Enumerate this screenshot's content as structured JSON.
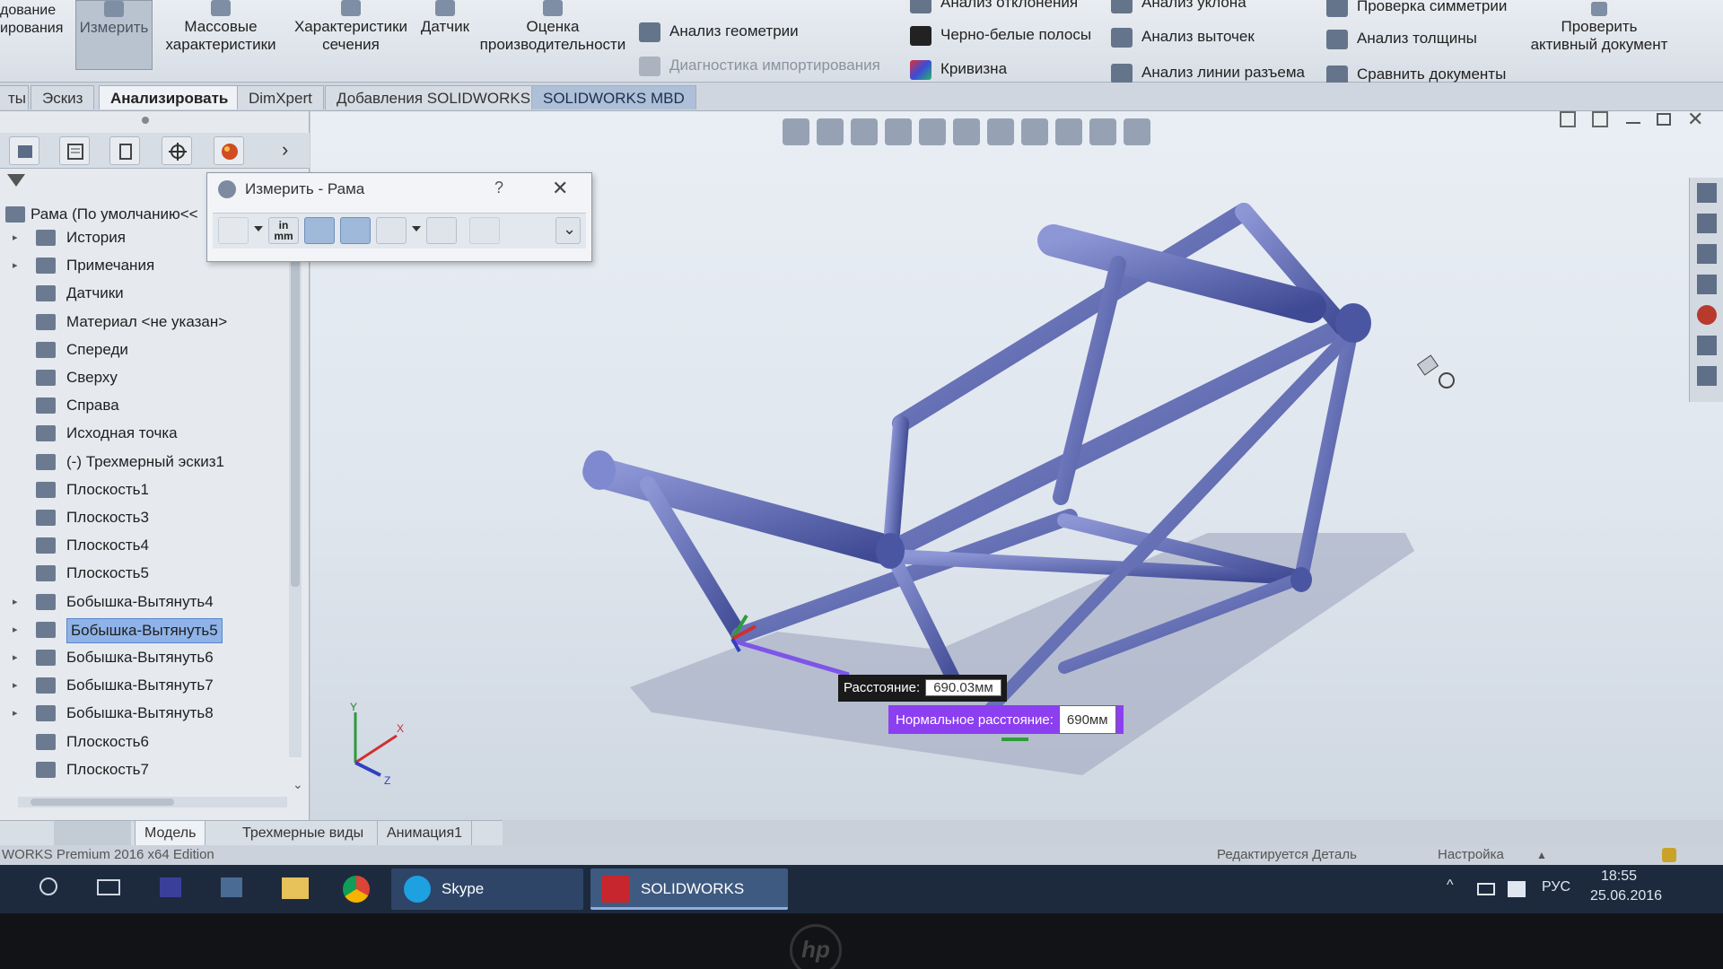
{
  "ribbon": {
    "left_partial": "дование\nирования",
    "tools": [
      {
        "label": "Измерить",
        "icon": "measure-icon"
      },
      {
        "label": "Массовые\nхарактеристики",
        "icon": "mass-properties-icon"
      },
      {
        "label": "Характеристики\nсечения",
        "icon": "section-properties-icon"
      },
      {
        "label": "Датчик",
        "icon": "sensor-icon"
      },
      {
        "label": "Оценка\nпроизводительности",
        "icon": "performance-icon"
      }
    ],
    "list_col1": [
      {
        "label": "Анализ геометрии",
        "icon": "geometry-analysis-icon"
      },
      {
        "label": "Диагностика импортирования",
        "icon": "import-diagnostics-icon",
        "disabled": true
      }
    ],
    "list_col2": [
      {
        "label": "Анализ отклонения",
        "icon": "deviation-analysis-icon"
      },
      {
        "label": "Черно-белые полосы",
        "icon": "zebra-stripes-icon"
      },
      {
        "label": "Кривизна",
        "icon": "curvature-icon"
      }
    ],
    "list_col3": [
      {
        "label": "Анализ уклона",
        "icon": "draft-analysis-icon"
      },
      {
        "label": "Анализ выточек",
        "icon": "undercut-analysis-icon"
      },
      {
        "label": "Анализ линии разъема",
        "icon": "parting-line-icon"
      }
    ],
    "list_col4": [
      {
        "label": "Проверка симметрии",
        "icon": "symmetry-check-icon"
      },
      {
        "label": "Анализ толщины",
        "icon": "thickness-analysis-icon"
      },
      {
        "label": "Сравнить документы",
        "icon": "compare-documents-icon"
      }
    ],
    "check_doc": "Проверить\nактивный документ"
  },
  "tabs": [
    "ты",
    "Эскиз",
    "Анализировать",
    "DimXpert",
    "Добавления SOLIDWORKS",
    "SOLIDWORKS MBD"
  ],
  "active_tab": "Анализировать",
  "tree": {
    "root": "Рама  (По умолчанию<<",
    "items": [
      {
        "label": "История",
        "expand": true
      },
      {
        "label": "Примечания",
        "expand": true
      },
      {
        "label": "Датчики"
      },
      {
        "label": "Материал <не указан>"
      },
      {
        "label": "Спереди"
      },
      {
        "label": "Сверху"
      },
      {
        "label": "Справа"
      },
      {
        "label": "Исходная точка"
      },
      {
        "label": "(-) Трехмерный эскиз1"
      },
      {
        "label": "Плоскость1"
      },
      {
        "label": "Плоскость3"
      },
      {
        "label": "Плоскость4"
      },
      {
        "label": "Плоскость5"
      },
      {
        "label": "Бобышка-Вытянуть4",
        "expand": true
      },
      {
        "label": "Бобышка-Вытянуть5",
        "expand": true,
        "selected": true
      },
      {
        "label": "Бобышка-Вытянуть6",
        "expand": true
      },
      {
        "label": "Бобышка-Вытянуть7",
        "expand": true
      },
      {
        "label": "Бобышка-Вытянуть8",
        "expand": true
      },
      {
        "label": "Плоскость6"
      },
      {
        "label": "Плоскость7"
      }
    ]
  },
  "measure_dialog": {
    "title": "Измерить - Рама",
    "help": "?",
    "close": "✕",
    "units_label": "in\nmm"
  },
  "callouts": {
    "distance_label": "Расстояние:",
    "distance_value": "690.03мм",
    "normal_label": "Нормальное расстояние:",
    "normal_value": "690мм"
  },
  "bottom_tabs": [
    "Модель",
    "Трехмерные виды",
    "Анимация1"
  ],
  "active_bottom_tab": "Модель",
  "status": {
    "edition": "WORKS Premium 2016 x64 Edition",
    "editing": "Редактируется Деталь",
    "custom": "Настройка"
  },
  "taskbar": {
    "skype": "Skype",
    "solidworks": "SOLIDWORKS Prem...",
    "lang": "РУС",
    "time": "18:55",
    "date": "25.06.2016"
  },
  "colors": {
    "frame_tube": "#5a66b0",
    "distance_callout": "#1a1a1a",
    "normal_callout": "#8c3ff0",
    "axis_x": "#d03030",
    "axis_y": "#2e9b3b",
    "axis_z": "#3040c0"
  },
  "brand": "hp"
}
